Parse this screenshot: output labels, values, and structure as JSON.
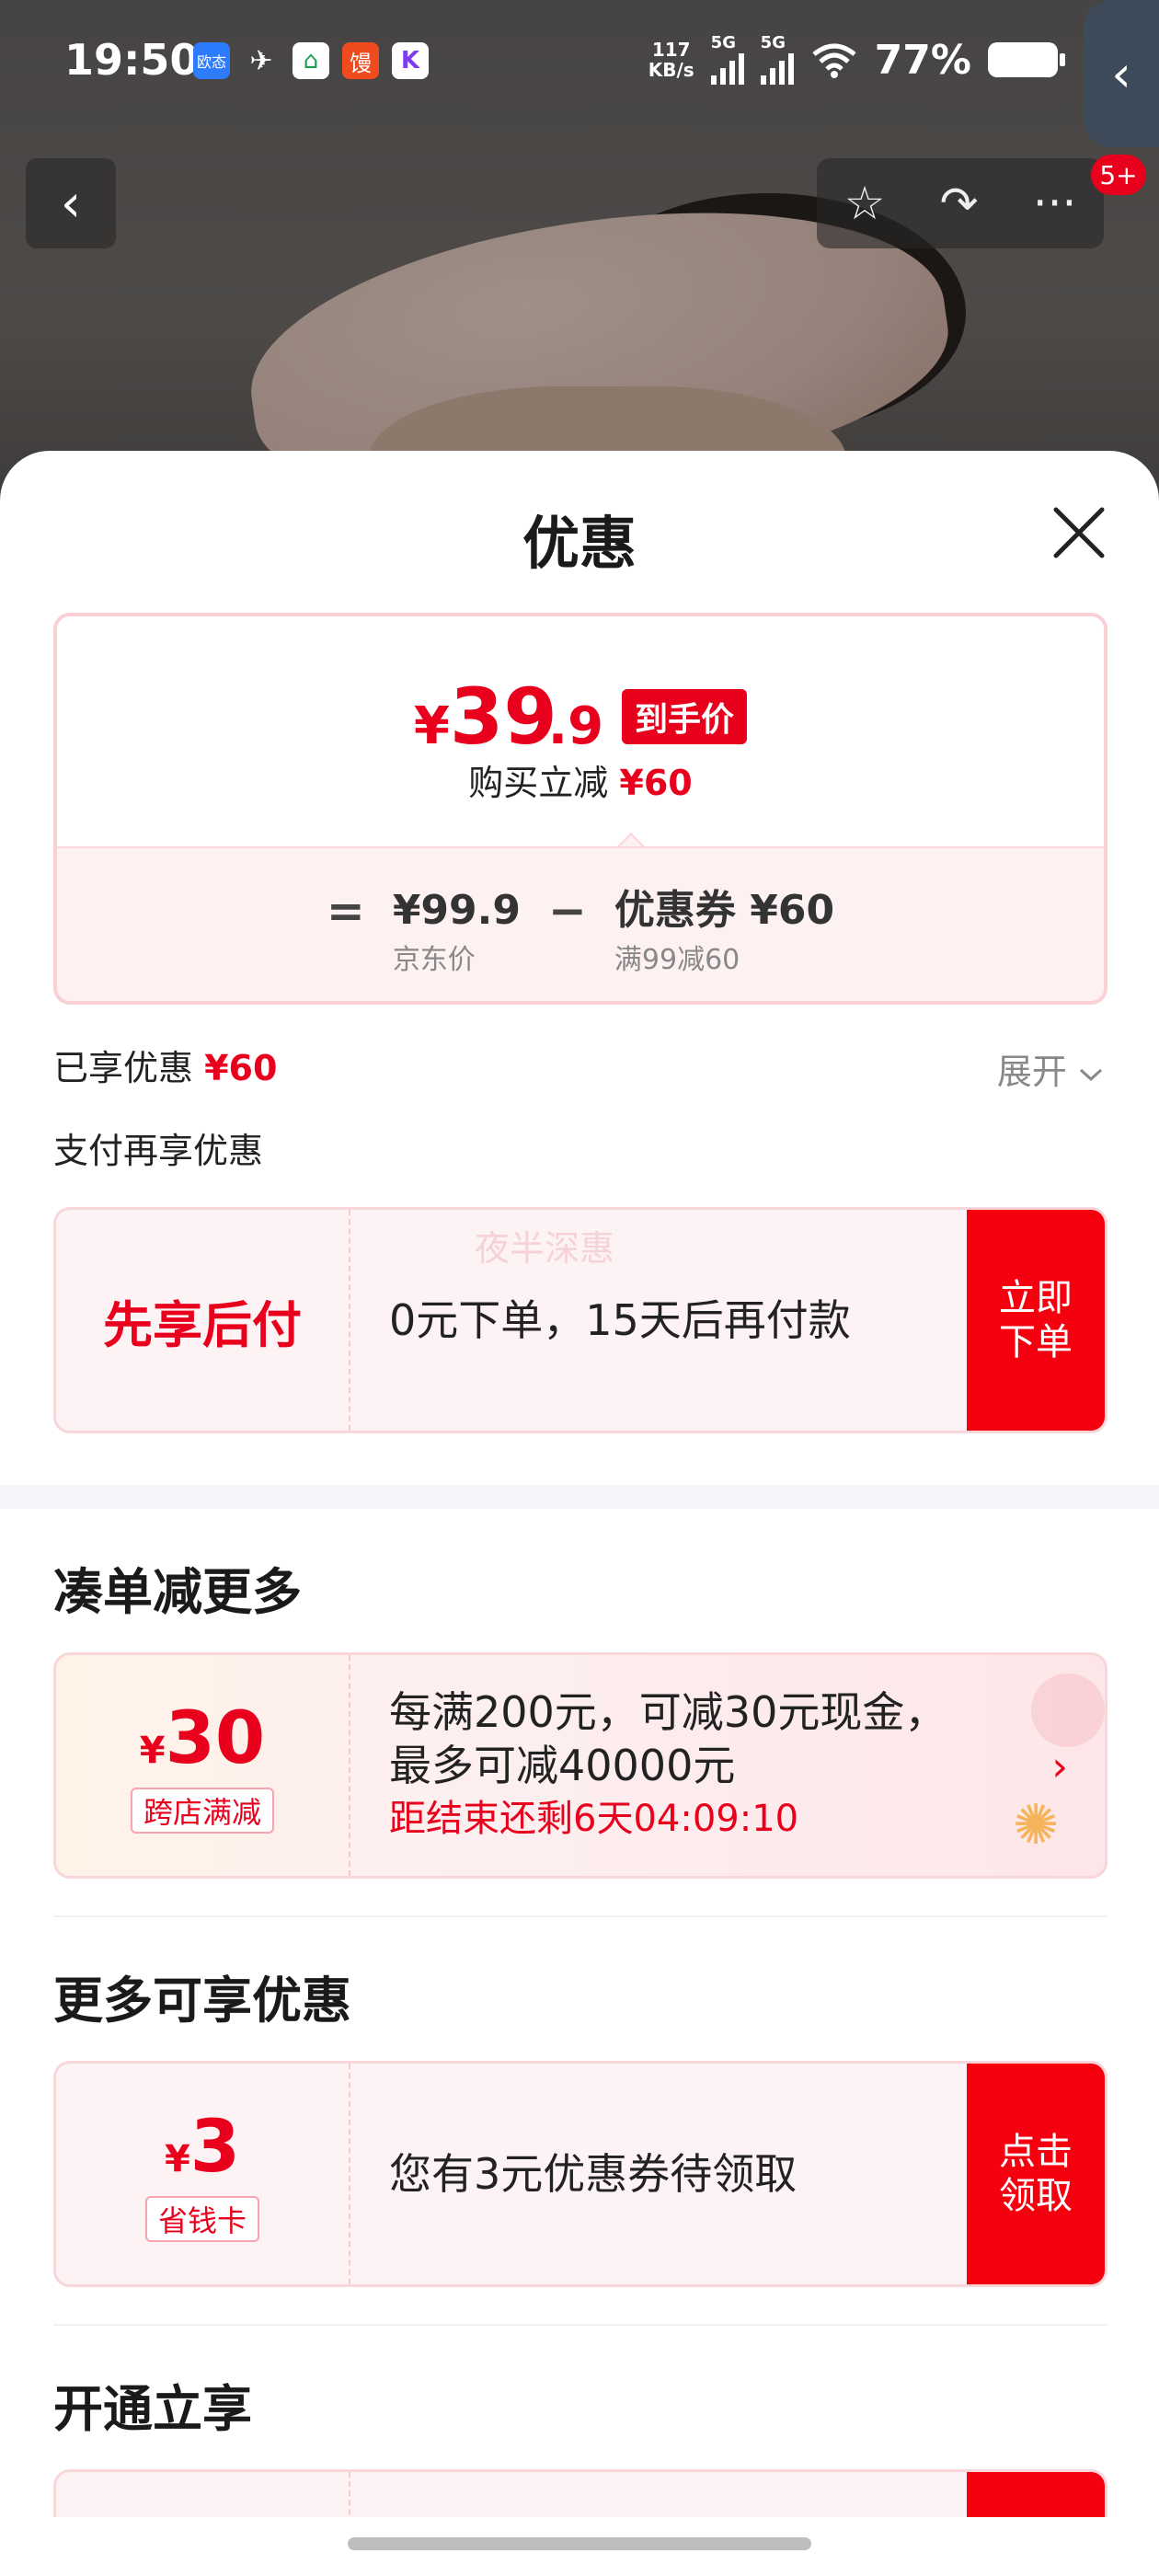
{
  "status_bar": {
    "time": "19:50",
    "apps": [
      "欧态",
      "✈",
      "⌂",
      "馒",
      "K"
    ],
    "net_speed": "117",
    "net_unit": "KB/s",
    "signal1": "5G",
    "signal2": "5G",
    "battery": "77%"
  },
  "nav": {
    "back_icon": "‹",
    "star_icon": "☆",
    "share_icon": "↷",
    "more_icon": "···",
    "badge": "5+",
    "side_tab_icon": "‹"
  },
  "sheet": {
    "title": "优惠",
    "price": {
      "yen": "¥",
      "integer": "39",
      "decimal": ".9",
      "tag": "到手价",
      "sub_label": "购买立减",
      "sub_value": "¥60"
    },
    "calc": {
      "equals": "=",
      "jd_price": "¥99.9",
      "jd_label": "京东价",
      "minus": "−",
      "coupon": "优惠券 ¥60",
      "coupon_rule": "满99减60"
    },
    "enjoyed_label": "已享优惠",
    "enjoyed_value": "¥60",
    "expand": "展开",
    "pay_title": "支付再享优惠",
    "bnpl": {
      "label": "先享后付",
      "desc": "0元下单，15天后再付款",
      "button_line1": "立即",
      "button_line2": "下单",
      "watermark": "夜半深惠"
    },
    "section_bundle": "凑单减更多",
    "bundle": {
      "yen": "¥",
      "amount": "30",
      "tag": "跨店满减",
      "line1": "每满200元，可减30元现金，",
      "line2": "最多可减40000元",
      "countdown": "距结束还剩6天04:09:10",
      "arrow": "›"
    },
    "section_more": "更多可享优惠",
    "save_card": {
      "yen": "¥",
      "amount": "3",
      "tag": "省钱卡",
      "desc": "您有3元优惠券待领取",
      "button_line1": "点击",
      "button_line2": "领取"
    },
    "section_open": "开通立享"
  },
  "colors": {
    "accent_red": "#e8001c",
    "button_red": "#f5000f",
    "card_bg": "#fdf3f4"
  }
}
